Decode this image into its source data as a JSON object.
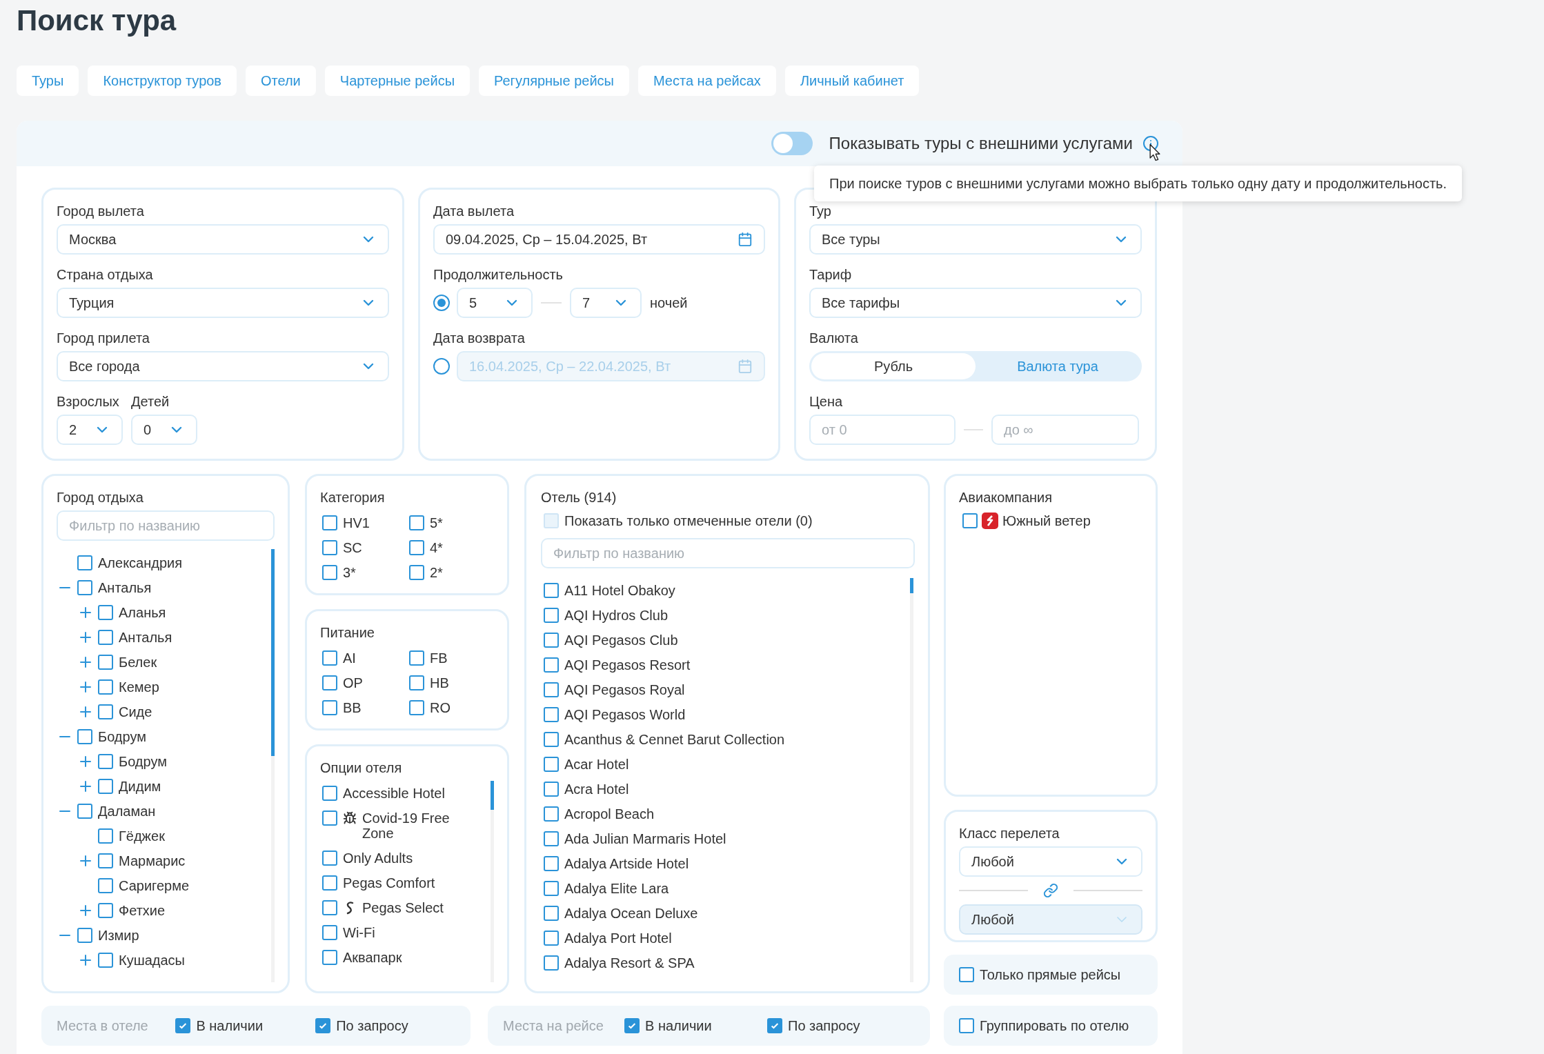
{
  "title": "Поиск тура",
  "nav_tabs": [
    "Туры",
    "Конструктор туров",
    "Отели",
    "Чартерные рейсы",
    "Регулярные рейсы",
    "Места на рейсах",
    "Личный кабинет"
  ],
  "external_services": {
    "label": "Показывать туры с внешними услугами",
    "on": false,
    "tooltip": "При поиске туров с внешними услугами можно выбрать только одну дату и продолжительность."
  },
  "departure": {
    "fields": [
      {
        "label": "Город вылета",
        "value": "Москва"
      },
      {
        "label": "Страна отдыха",
        "value": "Турция"
      },
      {
        "label": "Город прилета",
        "value": "Все города"
      }
    ],
    "adults": {
      "label": "Взрослых",
      "value": "2"
    },
    "children": {
      "label": "Детей",
      "value": "0"
    }
  },
  "dates": {
    "departure": {
      "label": "Дата вылета",
      "value": "09.04.2025, Ср – 15.04.2025, Вт"
    },
    "duration": {
      "label": "Продолжительность",
      "selected": true,
      "from": "5",
      "to": "7",
      "unit": "ночей"
    },
    "return": {
      "label": "Дата возврата",
      "selected": false,
      "value": "16.04.2025, Ср – 22.04.2025, Вт"
    }
  },
  "tour": {
    "fields": [
      {
        "label": "Тур",
        "value": "Все туры"
      },
      {
        "label": "Тариф",
        "value": "Все тарифы"
      }
    ],
    "currency": {
      "label": "Валюта",
      "options": [
        {
          "label": "Рубль",
          "selected": true
        },
        {
          "label": "Валюта тура",
          "selected": false
        }
      ]
    },
    "price": {
      "label": "Цена",
      "from_placeholder": "от 0",
      "to_placeholder": "до ∞"
    }
  },
  "resort_cities": {
    "title": "Город отдыха",
    "placeholder": "Фильтр по названию",
    "items": [
      {
        "label": "Александрия",
        "checked": false
      },
      {
        "label": "Анталья",
        "checked": false,
        "expanded": true,
        "children": [
          {
            "label": "Аланья",
            "checked": false,
            "expanded": false
          },
          {
            "label": "Анталья",
            "checked": false,
            "expanded": false
          },
          {
            "label": "Белек",
            "checked": false,
            "expanded": false
          },
          {
            "label": "Кемер",
            "checked": false,
            "expanded": false
          },
          {
            "label": "Сиде",
            "checked": false,
            "expanded": false
          }
        ]
      },
      {
        "label": "Бодрум",
        "checked": false,
        "expanded": true,
        "children": [
          {
            "label": "Бодрум",
            "checked": false,
            "expanded": false
          },
          {
            "label": "Дидим",
            "checked": false,
            "expanded": false
          }
        ]
      },
      {
        "label": "Даламан",
        "checked": false,
        "expanded": true,
        "children": [
          {
            "label": "Гёджек",
            "checked": false
          },
          {
            "label": "Мармарис",
            "checked": false,
            "expanded": false
          },
          {
            "label": "Саригерме",
            "checked": false
          },
          {
            "label": "Фетхие",
            "checked": false,
            "expanded": false
          }
        ]
      },
      {
        "label": "Измир",
        "checked": false,
        "expanded": true,
        "children": [
          {
            "label": "Кушадасы",
            "checked": false,
            "expanded": false
          }
        ]
      }
    ]
  },
  "category": {
    "title": "Категория",
    "items": [
      {
        "label": "HV1",
        "checked": false
      },
      {
        "label": "5*",
        "checked": false
      },
      {
        "label": "SC",
        "checked": false
      },
      {
        "label": "4*",
        "checked": false
      },
      {
        "label": "3*",
        "checked": false
      },
      {
        "label": "2*",
        "checked": false
      }
    ]
  },
  "meals": {
    "title": "Питание",
    "items": [
      {
        "label": "AI",
        "checked": false
      },
      {
        "label": "FB",
        "checked": false
      },
      {
        "label": "OP",
        "checked": false
      },
      {
        "label": "HB",
        "checked": false
      },
      {
        "label": "BB",
        "checked": false
      },
      {
        "label": "RO",
        "checked": false
      }
    ]
  },
  "hotel_options": {
    "title": "Опции отеля",
    "items": [
      {
        "label": "Accessible Hotel",
        "checked": false,
        "kind": "plain"
      },
      {
        "label": "Covid-19 Free Zone",
        "checked": false,
        "kind": "virus"
      },
      {
        "label": "Only Adults",
        "checked": false,
        "kind": "plain"
      },
      {
        "label": "Pegas Comfort",
        "checked": false,
        "kind": "plain"
      },
      {
        "label": "Pegas Select",
        "checked": false,
        "kind": "logo"
      },
      {
        "label": "Wi-Fi",
        "checked": false,
        "kind": "plain"
      },
      {
        "label": "Аквапарк",
        "checked": false,
        "kind": "plain"
      }
    ]
  },
  "hotels": {
    "title": "Отель (914)",
    "only_marked": {
      "label": "Показать только отмеченные отели (0)",
      "checked": false,
      "disabled": true
    },
    "placeholder": "Фильтр по названию",
    "items": [
      {
        "label": "A11 Hotel Obakoy",
        "checked": false
      },
      {
        "label": "AQI Hydros Club",
        "checked": false
      },
      {
        "label": "AQI Pegasos Club",
        "checked": false
      },
      {
        "label": "AQI Pegasos Resort",
        "checked": false
      },
      {
        "label": "AQI Pegasos Royal",
        "checked": false
      },
      {
        "label": "AQI Pegasos World",
        "checked": false
      },
      {
        "label": "Acanthus & Cennet Barut Collection",
        "checked": false
      },
      {
        "label": "Acar Hotel",
        "checked": false
      },
      {
        "label": "Acra Hotel",
        "checked": false
      },
      {
        "label": "Acropol Beach",
        "checked": false
      },
      {
        "label": "Ada Julian Marmaris Hotel",
        "checked": false
      },
      {
        "label": "Adalya Artside Hotel",
        "checked": false
      },
      {
        "label": "Adalya Elite Lara",
        "checked": false
      },
      {
        "label": "Adalya Ocean Deluxe",
        "checked": false
      },
      {
        "label": "Adalya Port Hotel",
        "checked": false
      },
      {
        "label": "Adalya Resort & SPA",
        "checked": false
      }
    ]
  },
  "airlines": {
    "title": "Авиакомпания",
    "items": [
      {
        "label": "Южный ветер",
        "checked": false
      }
    ]
  },
  "flight_class": {
    "title": "Класс перелета",
    "selects": [
      {
        "value": "Любой",
        "disabled": false
      },
      {
        "value": "Любой",
        "disabled": true
      }
    ]
  },
  "direct_only": {
    "label": "Только прямые рейсы",
    "checked": false
  },
  "group_by_hotel": {
    "label": "Группировать по отелю",
    "checked": false
  },
  "availability": [
    {
      "label": "Места в отеле",
      "options": [
        {
          "label": "В наличии",
          "checked": true
        },
        {
          "label": "По запросу",
          "checked": true
        }
      ]
    },
    {
      "label": "Места на рейсе",
      "options": [
        {
          "label": "В наличии",
          "checked": true
        },
        {
          "label": "По запросу",
          "checked": true
        }
      ]
    }
  ]
}
